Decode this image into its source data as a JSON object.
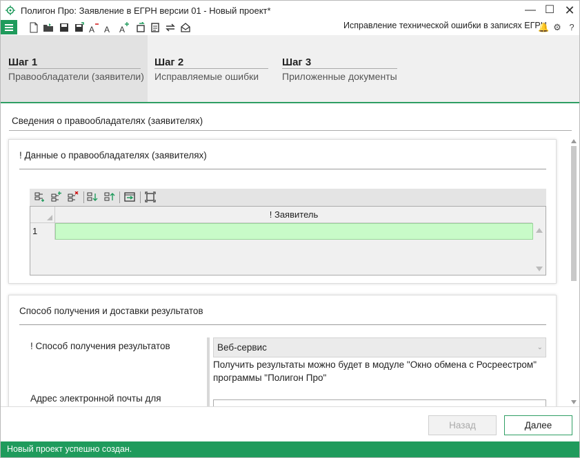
{
  "window": {
    "title": "Полигон Про: Заявление в ЕГРН версии 01 - Новый проект*",
    "minimize_glyph": "—",
    "maximize_glyph": "☐",
    "close_glyph": "✕"
  },
  "toolbar": {
    "icons": [
      "new-document-icon",
      "open-folder-icon",
      "save-icon",
      "save-as-icon",
      "font-decrease-icon",
      "font-normal-icon",
      "font-increase-icon",
      "refresh-icon",
      "list-icon",
      "exchange-icon",
      "envelope-icon"
    ],
    "mode_label": "Исправление технической ошибки в записях ЕГРН",
    "bell_glyph": "🔔",
    "settings_glyph": "⚙",
    "help_glyph": "?"
  },
  "steps": [
    {
      "number": "Шаг 1",
      "title": "Правообладатели (заявители)",
      "active": true
    },
    {
      "number": "Шаг 2",
      "title": "Исправляемые ошибки",
      "active": false
    },
    {
      "number": "Шаг 3",
      "title": "Приложенные документы",
      "active": false
    }
  ],
  "content": {
    "section_title": "Сведения о правообладателях (заявителях)",
    "applicants_panel": {
      "title": "! Данные о правообладателях (заявителях)",
      "grid_toolbar_icons": [
        "add-row-icon",
        "add-row-after-icon",
        "delete-row-icon",
        "move-down-icon",
        "move-up-icon",
        "import-icon",
        "fit-icon"
      ],
      "column_header": "! Заявитель",
      "rows": [
        {
          "num": "1",
          "value": ""
        }
      ]
    },
    "delivery_panel": {
      "title": "Способ получения и доставки результатов",
      "method_label": "! Способ получения результатов",
      "method_value": "Веб-сервис",
      "method_hint": "Получить результаты можно будет в модуле \"Окно обмена с Росреестром\" программы \"Полигон Про\"",
      "email_label": "Адрес электронной почты для",
      "email_value": ""
    }
  },
  "footer": {
    "back_label": "Назад",
    "next_label": "Далее"
  },
  "status": "Новый проект успешно создан.",
  "colors": {
    "accent": "#1f9b5c",
    "row_highlight": "#c8fbc8"
  }
}
